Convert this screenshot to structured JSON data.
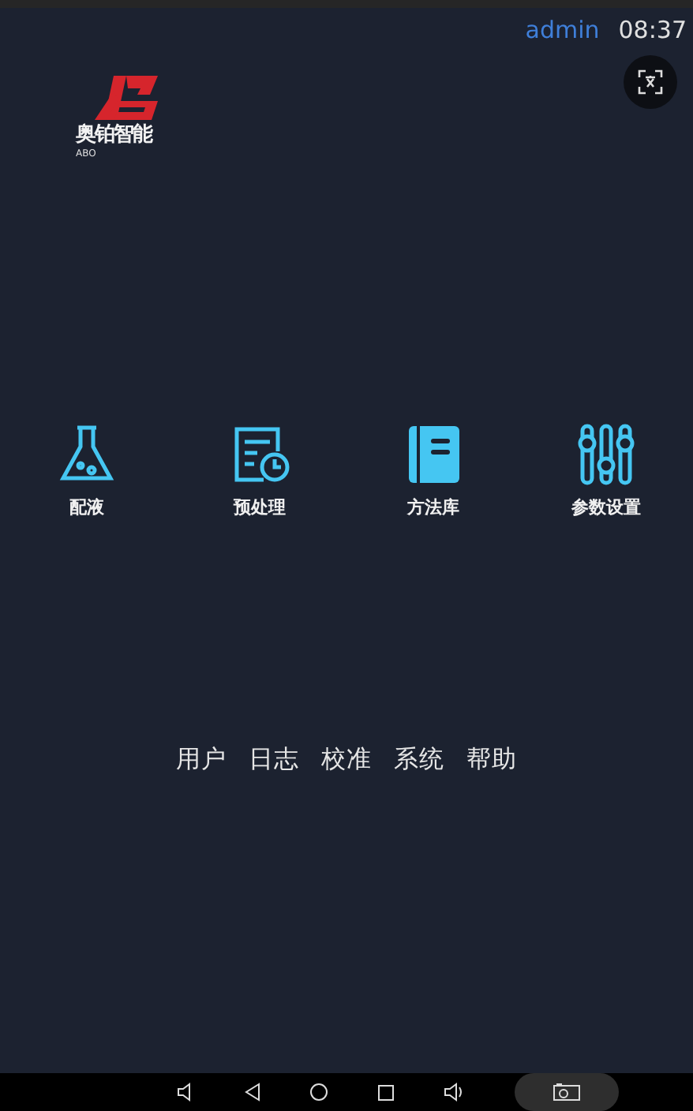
{
  "header": {
    "user": "admin",
    "time": "08:37"
  },
  "logo": {
    "name": "奥铂智能",
    "sub": "ABO"
  },
  "modules": [
    {
      "kind": "flask",
      "label": "配液"
    },
    {
      "kind": "doc-clock",
      "label": "预处理"
    },
    {
      "kind": "book",
      "label": "方法库"
    },
    {
      "kind": "sliders",
      "label": "参数设置"
    }
  ],
  "links": [
    "用户",
    "日志",
    "校准",
    "系统",
    "帮助"
  ]
}
